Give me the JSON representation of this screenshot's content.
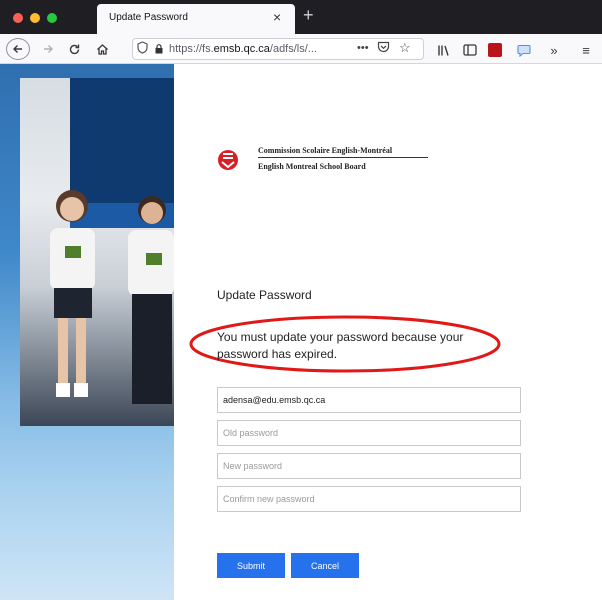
{
  "browser": {
    "tab_title": "Update Password",
    "tab_close": "×",
    "new_tab": "+",
    "url_prefix": "https://fs.",
    "url_domain": "emsb.qc.ca",
    "url_suffix": "/adfs/ls/...",
    "url_more": "•••",
    "icons": {
      "back": "back-arrow-icon",
      "forward": "forward-arrow-icon",
      "reload": "reload-icon",
      "home": "home-icon",
      "library": "library-icon",
      "sidebar": "sidebar-icon",
      "overflow": "overflow-chevron-icon",
      "menu": "hamburger-menu-icon"
    }
  },
  "org": {
    "name_fr": "Commission Scolaire English-Montréal",
    "name_en": "English Montreal School Board",
    "brand_color": "#d81f26"
  },
  "form": {
    "heading": "Update Password",
    "message": "You must update your password because your password has expired.",
    "email_value": "adensa@edu.emsb.qc.ca",
    "old_password_placeholder": "Old password",
    "new_password_placeholder": "New password",
    "confirm_password_placeholder": "Confirm new password",
    "submit_label": "Submit",
    "cancel_label": "Cancel",
    "button_color": "#2672ec",
    "highlight_color": "#e01818"
  }
}
